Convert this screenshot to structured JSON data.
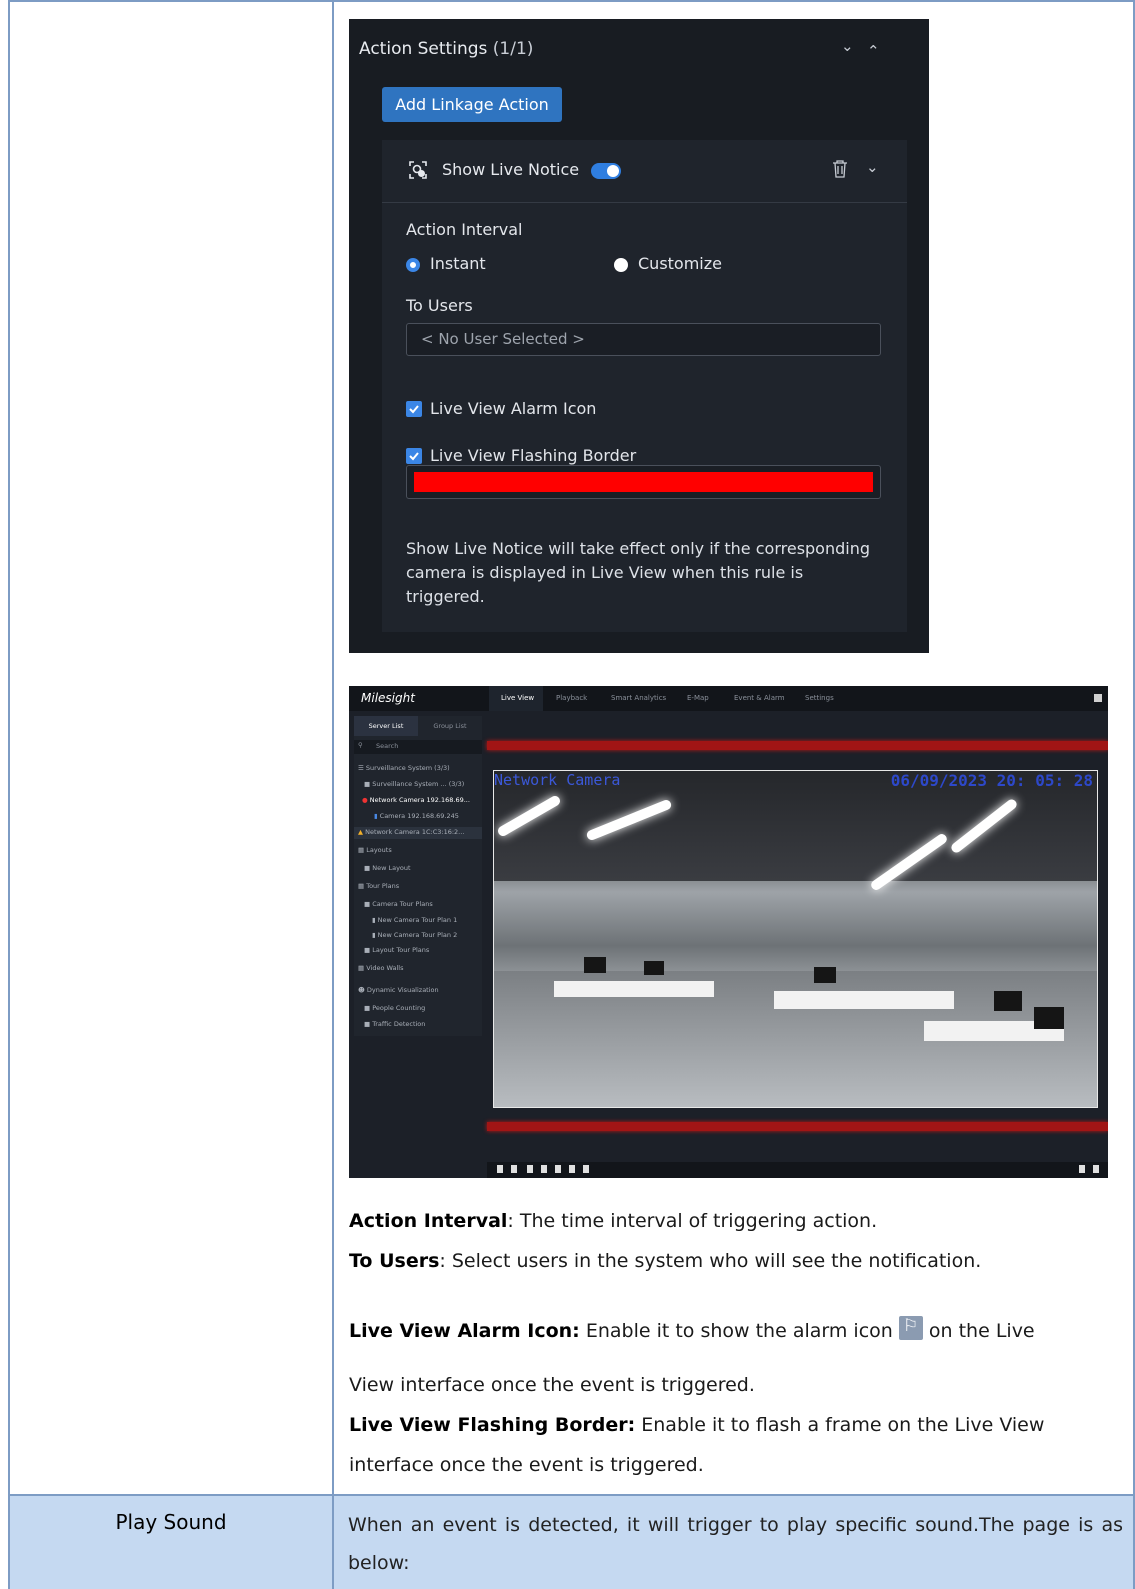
{
  "action_panel": {
    "title": "Action Settings",
    "count": "(1/1)",
    "add_button": "Add Linkage Action",
    "card": {
      "title": "Show Live Notice",
      "toggle_on": true,
      "action_interval_label": "Action Interval",
      "radio_instant": "Instant",
      "radio_customize": "Customize",
      "to_users_label": "To Users",
      "users_placeholder": "< No User Selected >",
      "check_alarm_icon": "Live View Alarm Icon",
      "check_flashing_border": "Live View Flashing Border",
      "border_color": "#ff0000",
      "note": "Show Live Notice will take effect only if the corresponding camera is displayed in Live View when this rule is triggered."
    }
  },
  "live_view": {
    "logo": "Milesight",
    "tabs": [
      "Live View",
      "Playback",
      "Smart Analytics",
      "E-Map",
      "Event & Alarm",
      "Settings"
    ],
    "server_list": "Server List",
    "group_list": "Group List",
    "search_placeholder": "Search",
    "tree": [
      "Surveillance System",
      "Surveillance System ...",
      "Network Camera 192.168.69...",
      "Camera 192.168.69.245",
      "Network Camera 1C:C3:16:2...",
      "Layouts",
      "New Layout",
      "Tour Plans",
      "Camera Tour Plans",
      "New Camera Tour Plan 1",
      "New Camera Tour Plan 2",
      "Layout Tour Plans",
      "Video Walls",
      "Dynamic Visualization",
      "People Counting",
      "Traffic Detection"
    ],
    "tree_counts": [
      "(3/3)",
      "(3/3)"
    ],
    "osd_left": "Network Camera",
    "osd_right": "06/09/2023  20: 05: 28"
  },
  "descriptions": {
    "action_interval_term": "Action Interval",
    "action_interval_text": ": The time interval of triggering action.",
    "to_users_term": "To Users",
    "to_users_text": ": Select users in the system who will see the notification.",
    "alarm_icon_term": "Live View Alarm Icon:",
    "alarm_icon_text1": " Enable it to show the alarm icon ",
    "alarm_icon_text2": " on the Live",
    "alarm_icon_text3": "View interface once the event is triggered.",
    "flashing_term": "Live View Flashing Border:",
    "flashing_text1": " Enable it to flash a frame on the Live View",
    "flashing_text2": "interface once the event is triggered."
  },
  "play_sound_row": {
    "label": "Play Sound",
    "text": "When an event is detected, it will trigger to play specific sound.The page is as below:"
  }
}
